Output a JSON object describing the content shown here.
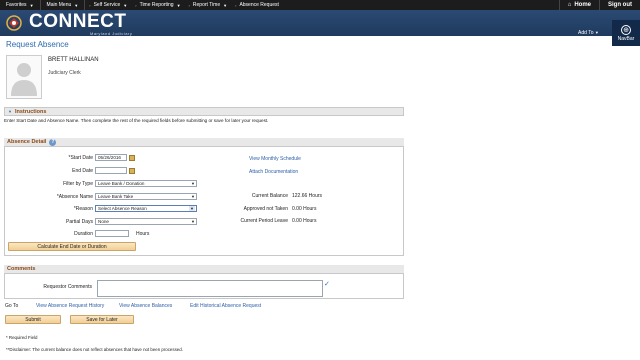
{
  "topnav": {
    "favorites": "Favorites",
    "main_menu": "Main Menu",
    "breadcrumbs": [
      "Self Service",
      "Time Reporting",
      "Report Time",
      "Absence Request"
    ],
    "home": "Home",
    "sign_out": "Sign out"
  },
  "header": {
    "logo_text": "CONNECT",
    "logo_sub": "Maryland Judiciary",
    "add_to": "Add To",
    "navbar": "NavBar"
  },
  "page": {
    "title": "Request Absence"
  },
  "employee": {
    "name": "BRETT HALLINAN",
    "job_title": "Judiciary Clerk"
  },
  "instructions": {
    "header": "Instructions",
    "text": "Enter Start Date and Absence Name. Then complete the rest of the required fields before submitting or save for later your request."
  },
  "absence_detail": {
    "header": "Absence Detail",
    "start_date_label": "*Start Date",
    "start_date_value": "05/26/2016",
    "end_date_label": "End Date",
    "end_date_value": "",
    "filter_type_label": "Filter by Type",
    "filter_type_value": "Leave Bank / Donation",
    "absence_name_label": "*Absence Name",
    "absence_name_value": "Leave Bank Take",
    "reason_label": "*Reason",
    "reason_value": "Select Absence Reason",
    "partial_days_label": "Partial Days",
    "partial_days_value": "None",
    "duration_label": "Duration",
    "duration_value": "",
    "hours_label": "Hours",
    "calc_button": "Calculate End Date or Duration",
    "view_schedule_link": "View Monthly Schedule",
    "attach_link": "Attach Documentation",
    "current_balance_label": "Current Balance",
    "current_balance_value": "122.66 Hours",
    "approved_label": "Approved not Taken",
    "approved_value": "0.00 Hours",
    "current_period_label": "Current Period Leave",
    "current_period_value": "0.00 Hours"
  },
  "comments": {
    "header": "Comments",
    "requestor_label": "Requestor Comments"
  },
  "goto": {
    "label": "Go To",
    "links": [
      "View Absence Request History",
      "View Absence Balances",
      "Edit Historical Absence Request"
    ]
  },
  "actions": {
    "submit": "Submit",
    "save_later": "Save for Later"
  },
  "footer": {
    "required": "* Required Field",
    "disclaimer": "**Disclaimer: The current balance does not reflect absences that have not been processed."
  },
  "colors": {
    "header_bg": "#1f3a5e",
    "link": "#2c5ea8",
    "section_title": "#8a4a15",
    "button": "#f2cf94"
  }
}
